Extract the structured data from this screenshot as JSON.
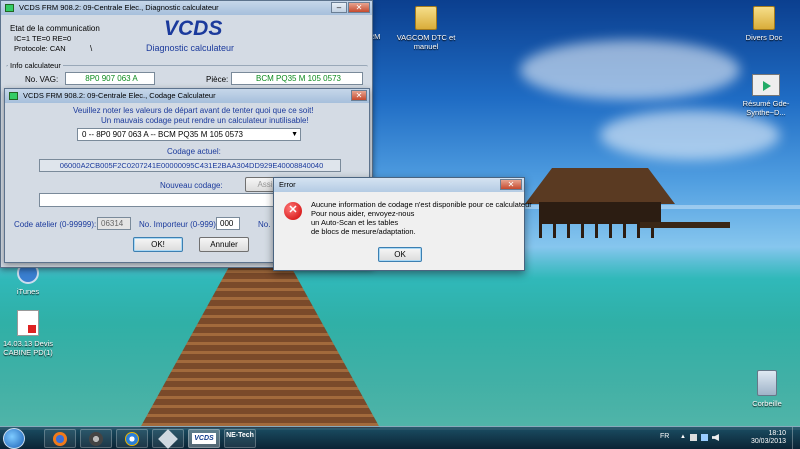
{
  "desktop": {
    "icons": {
      "vagcom": {
        "label": "VAGCOM DTC et manuel"
      },
      "vcds_partial": {
        "label": "- FRM"
      },
      "divers": {
        "label": "Divers Doc"
      },
      "resume": {
        "label": "Résumé Gde-Synthe~D..."
      },
      "itunes": {
        "label": "iTunes"
      },
      "devis": {
        "label": "14.03.13 Devis CABINE PD(1)"
      },
      "corbeille": {
        "label": "Corbeille"
      }
    }
  },
  "main_window": {
    "title": "VCDS FRM 908.2: 09-Centrale Elec.,  Diagnostic calculateur",
    "comm": {
      "heading": "Etat de la communication",
      "status": "IC=1  TE=0   RE=0",
      "protocol": "Protocole: CAN",
      "indicator": "\\"
    },
    "brand": "VCDS",
    "brand_subtitle": "Diagnostic calculateur",
    "info": {
      "heading": "Info calculateur",
      "vag_label": "No. VAG:",
      "vag_value": "8P0 907 063 A",
      "piece_label": "Pièce:",
      "piece_value": "BCM PQ35  M    105 0573"
    }
  },
  "coding_window": {
    "title": "VCDS FRM 908.2: 09-Centrale Elec.,  Codage Calculateur",
    "warning1": "Veuillez noter les valeurs de départ avant de tenter quoi que ce soit!",
    "warning2": "Un mauvais codage peut rendre un calculateur inutilisable!",
    "select_value": "0 -- 8P0 907 063 A -- BCM PQ35  M    105 0573",
    "current_label": "Codage actuel:",
    "current_value": "06000A2CB005F2C0207241E00000095C431E2BAA304DD929E40008840040",
    "new_label": "Nouveau codage:",
    "assist_label": "Assi",
    "new_value": "",
    "shop_label": "Code atelier (0-99999):",
    "shop_value": "06314",
    "importer_label": "No. Importeur (0-999):",
    "importer_value": "000",
    "dealer_label": "No.",
    "ok_label": "OK!",
    "cancel_label": "Annuler"
  },
  "error_dialog": {
    "title": "Error",
    "message": "Aucune information de codage n'est disponible pour ce calculateur\nPour nous aider, envoyez-nous\nun Auto-Scan et les tables\nde blocs de mesure/adaptation.",
    "ok_label": "OK"
  },
  "taskbar": {
    "vcds_label": "VCDS",
    "netech_label": "NE-Tech",
    "lang": "FR",
    "time": "18:10",
    "date": "30/03/2013"
  },
  "colors": {
    "accent_blue": "#1b3a9c",
    "value_green": "#0b8a1c",
    "error_red": "#cc0000"
  }
}
